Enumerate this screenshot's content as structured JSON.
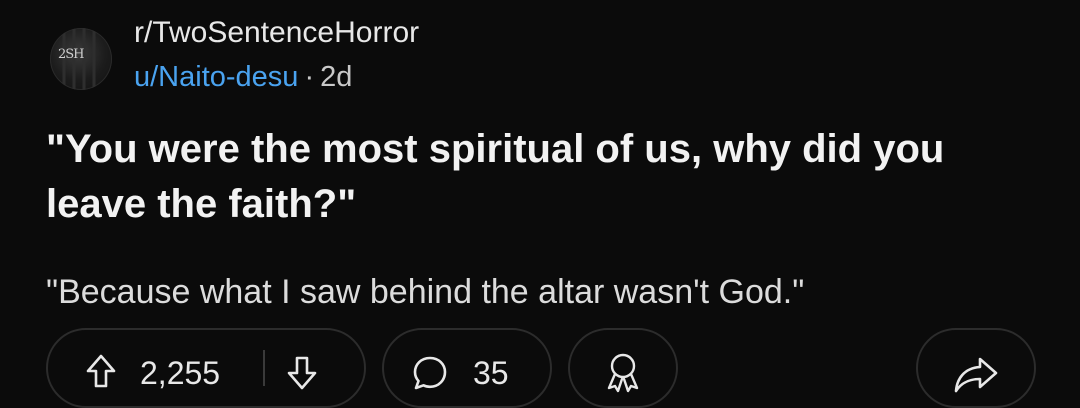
{
  "post": {
    "community": "r/TwoSentenceHorror",
    "avatar_label": "2SH",
    "author": "u/Naito-desu",
    "separator": "·",
    "age": "2d",
    "title": "\"You were the most spiritual of us, why did you leave the faith?\"",
    "body": "\"Because what I saw behind the altar wasn't God.\""
  },
  "actions": {
    "upvote_icon": "arrow-up-icon",
    "score": "2,255",
    "downvote_icon": "arrow-down-icon",
    "comment_icon": "speech-bubble-icon",
    "comment_count": "35",
    "award_icon": "award-ribbon-icon",
    "share_icon": "share-arrow-icon"
  }
}
